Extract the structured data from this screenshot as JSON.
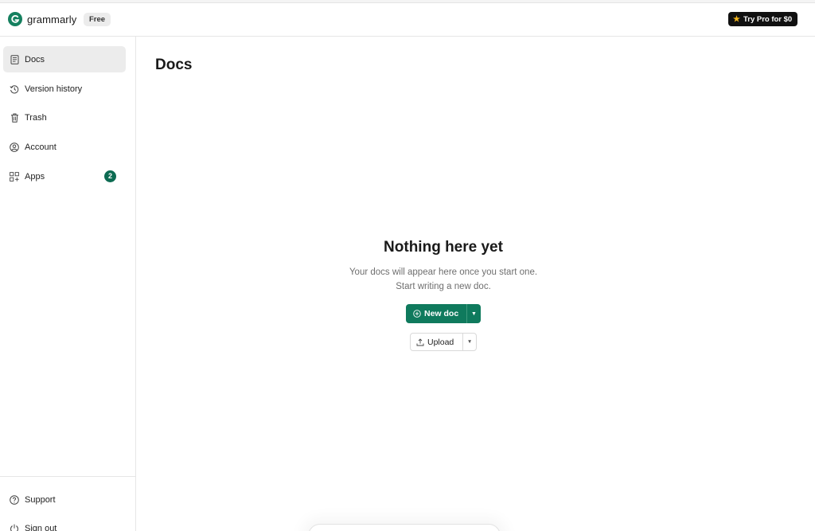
{
  "header": {
    "brand": "grammarly",
    "plan_badge": "Free",
    "pro_button": "Try Pro for $0",
    "icons": {
      "logo": "grammarly-logo-icon",
      "star": "star-icon"
    }
  },
  "sidebar": {
    "items": [
      {
        "label": "Docs",
        "icon": "document-icon",
        "active": true
      },
      {
        "label": "Version history",
        "icon": "history-icon"
      },
      {
        "label": "Trash",
        "icon": "trash-icon"
      },
      {
        "label": "Account",
        "icon": "account-icon"
      },
      {
        "label": "Apps",
        "icon": "apps-icon",
        "badge": "2"
      }
    ],
    "footer_items": [
      {
        "label": "Support",
        "icon": "help-icon"
      },
      {
        "label": "Sign out",
        "icon": "power-icon"
      }
    ]
  },
  "main": {
    "title": "Docs",
    "empty_state": {
      "title": "Nothing here yet",
      "line1": "Your docs will appear here once you start one.",
      "line2": "Start writing a new doc."
    },
    "new_doc_button": "New doc",
    "upload_button": "Upload"
  },
  "colors": {
    "brand_green": "#15805f",
    "button_green": "#0f7a5d",
    "badge_green": "#0d6b52",
    "pro_dark": "#111111",
    "star_yellow": "#f3b61c",
    "active_bg": "#ececec"
  }
}
